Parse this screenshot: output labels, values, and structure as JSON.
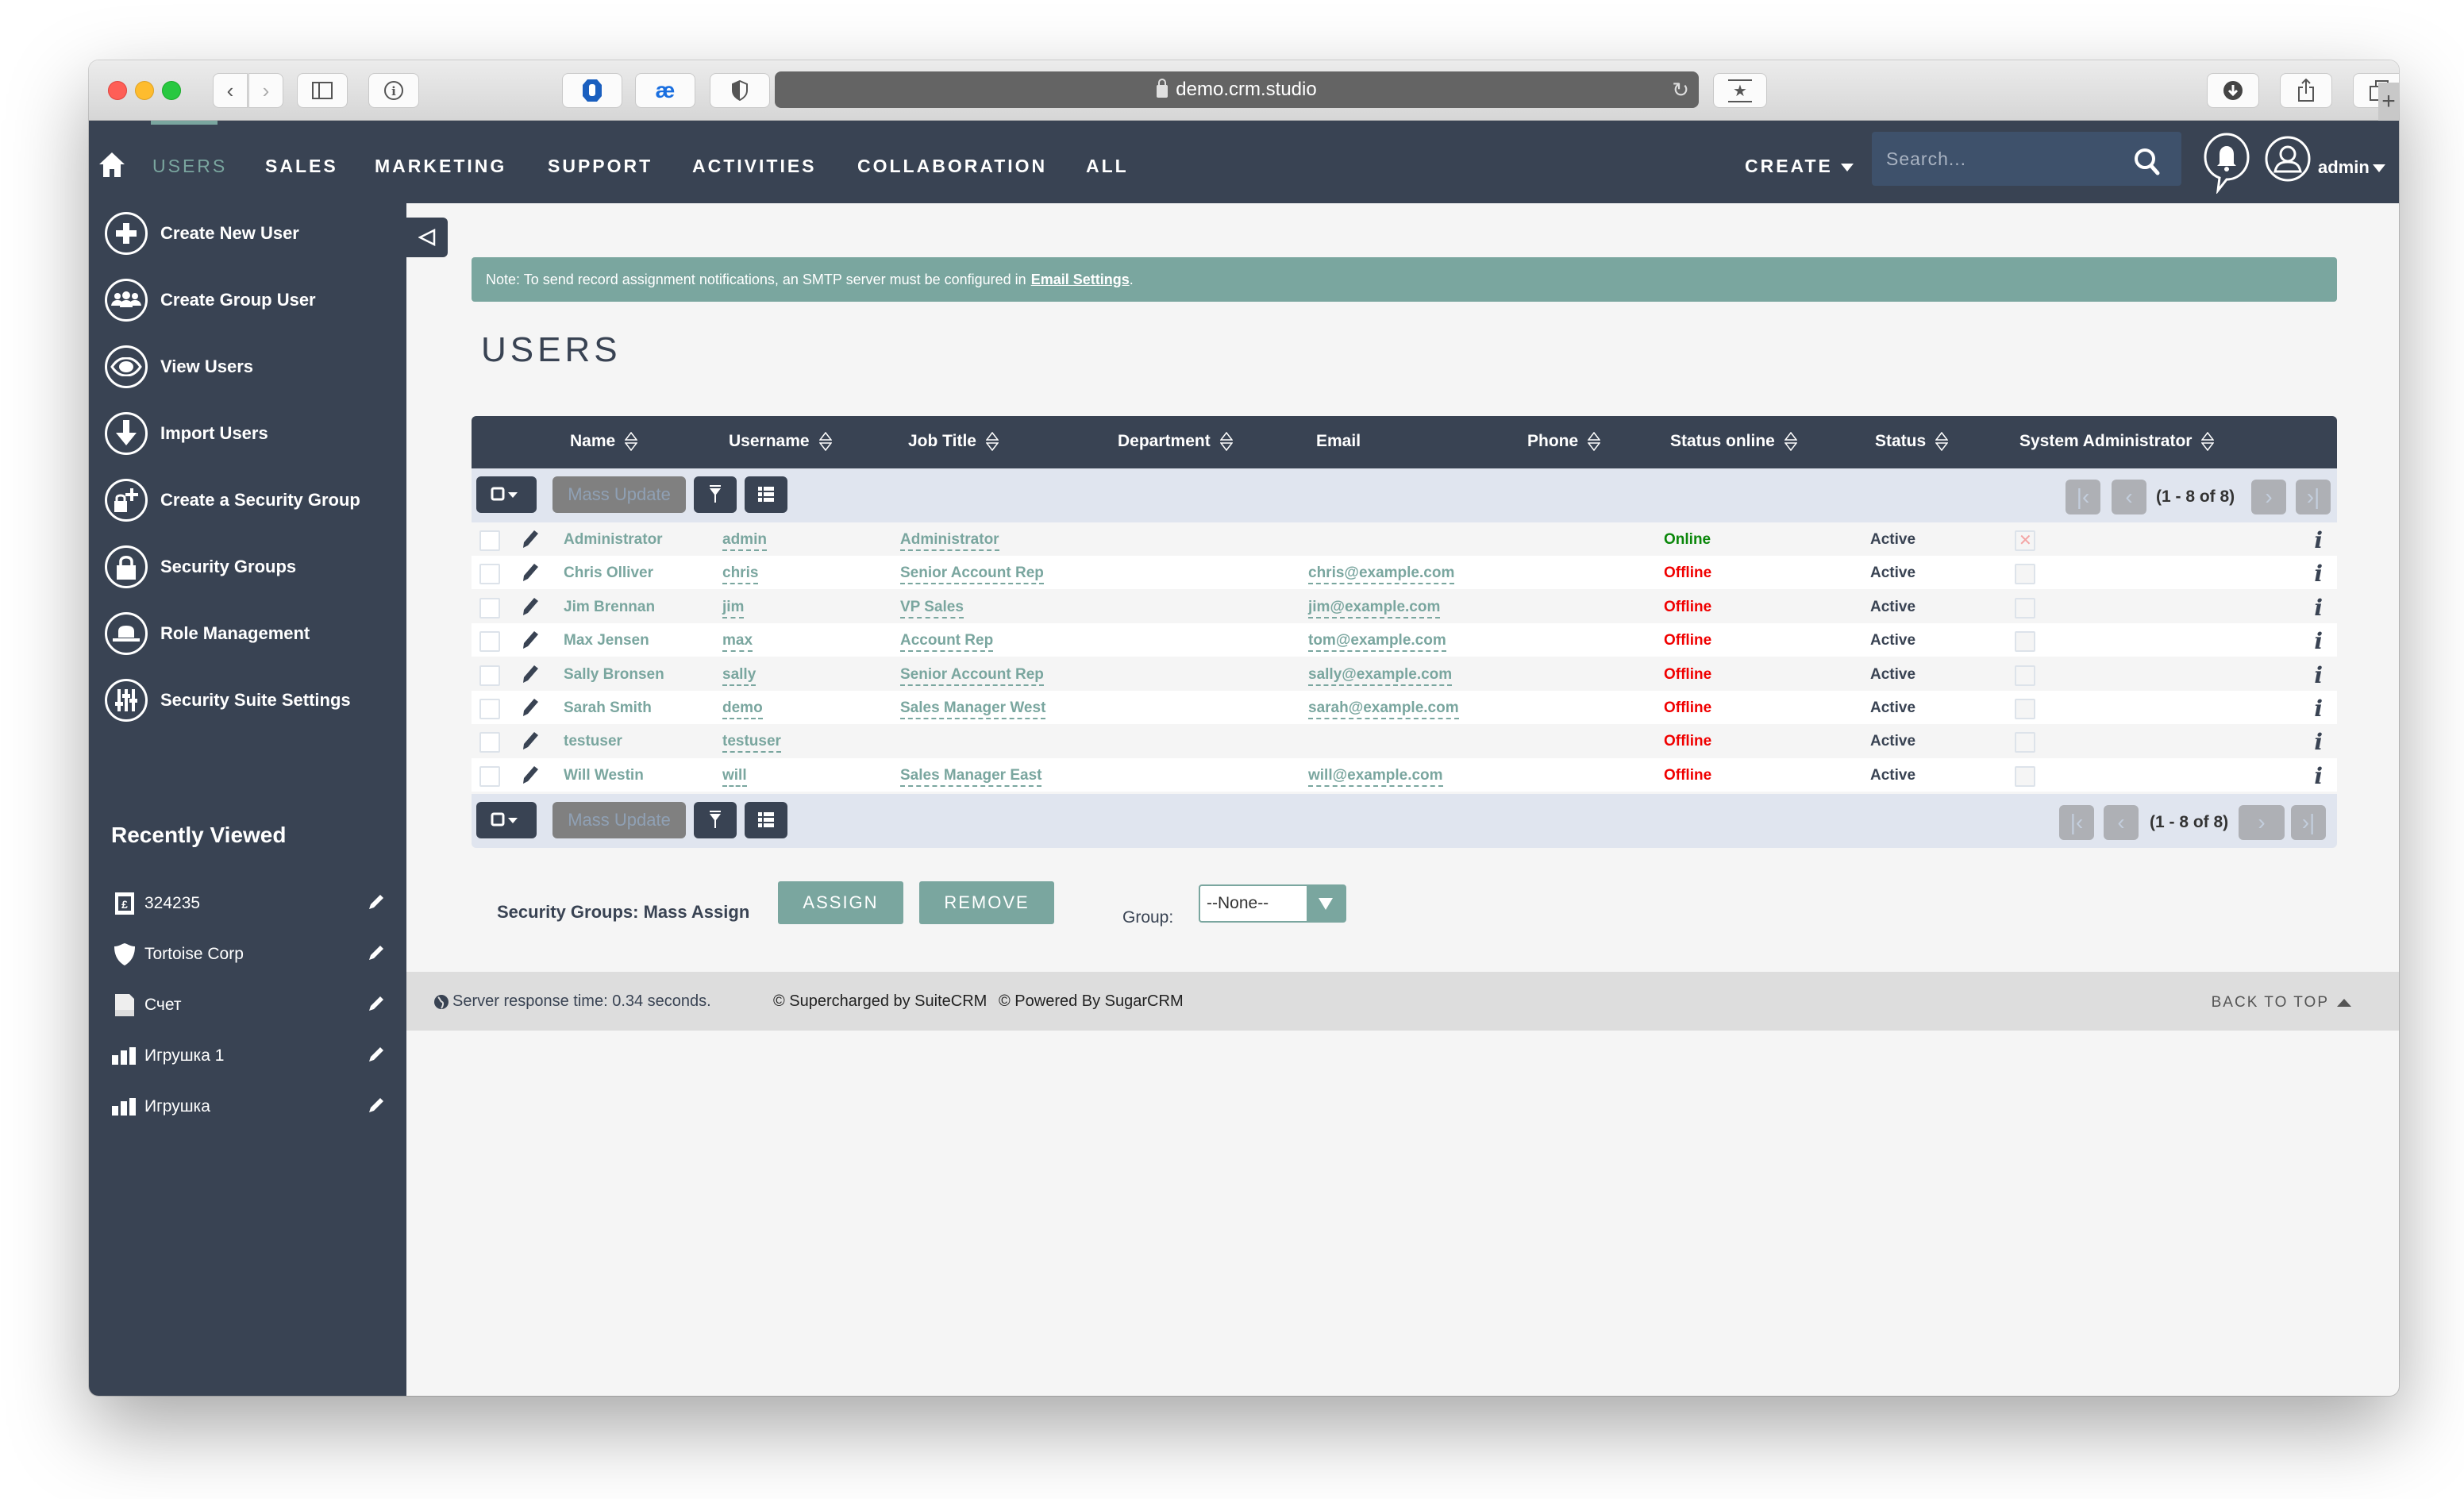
{
  "browser": {
    "url": "demo.crm.studio",
    "toolbar_icons": [
      "back-icon",
      "forward-icon",
      "sidebar-icon",
      "info-icon",
      "adblock-hand-icon",
      "ae-extension-icon",
      "shield-icon",
      "reader-star-icon",
      "download-icon",
      "share-icon",
      "tabs-icon",
      "new-tab-icon"
    ],
    "new_tab": "+"
  },
  "navbar": {
    "items": [
      {
        "label": "USERS",
        "active": true
      },
      {
        "label": "SALES"
      },
      {
        "label": "MARKETING"
      },
      {
        "label": "SUPPORT"
      },
      {
        "label": "ACTIVITIES"
      },
      {
        "label": "COLLABORATION"
      },
      {
        "label": "ALL"
      }
    ],
    "create_label": "CREATE",
    "search_placeholder": "Search...",
    "user_label": "admin"
  },
  "sidebar": {
    "actions": [
      {
        "label": "Create New User",
        "icon": "plus-icon"
      },
      {
        "label": "Create Group User",
        "icon": "group-icon"
      },
      {
        "label": "View Users",
        "icon": "eye-icon"
      },
      {
        "label": "Import Users",
        "icon": "import-arrow-icon"
      },
      {
        "label": "Create a Security Group",
        "icon": "lock-plus-icon"
      },
      {
        "label": "Security Groups",
        "icon": "lock-icon"
      },
      {
        "label": "Role Management",
        "icon": "hat-icon"
      },
      {
        "label": "Security Suite Settings",
        "icon": "sliders-icon"
      }
    ],
    "recent_title": "Recently Viewed",
    "recent": [
      {
        "label": "324235",
        "icon": "invoice-pound-icon"
      },
      {
        "label": "Tortoise Corp",
        "icon": "shield-account-icon"
      },
      {
        "label": "Счет",
        "icon": "pdf-document-icon"
      },
      {
        "label": "Игрушка 1",
        "icon": "product-bars-icon"
      },
      {
        "label": "Игрушка",
        "icon": "product-bars-icon"
      }
    ]
  },
  "notice": {
    "text": "Note: To send record assignment notifications, an SMTP server must be configured in",
    "link": "Email Settings",
    "suffix": "."
  },
  "page_title": "USERS",
  "table": {
    "columns": [
      "Name",
      "Username",
      "Job Title",
      "Department",
      "Email",
      "Phone",
      "Status online",
      "Status",
      "System Administrator"
    ],
    "sortable": [
      true,
      true,
      true,
      true,
      false,
      true,
      true,
      true,
      true
    ],
    "rows": [
      {
        "name": "Administrator",
        "username": "admin",
        "job_title": "Administrator",
        "department": "",
        "email": "",
        "phone": "",
        "status_online": "Online",
        "status": "Active",
        "is_admin": true
      },
      {
        "name": "Chris Olliver",
        "username": "chris",
        "job_title": "Senior Account Rep",
        "department": "",
        "email": "chris@example.com",
        "phone": "",
        "status_online": "Offline",
        "status": "Active",
        "is_admin": false
      },
      {
        "name": "Jim Brennan",
        "username": "jim",
        "job_title": "VP Sales",
        "department": "",
        "email": "jim@example.com",
        "phone": "",
        "status_online": "Offline",
        "status": "Active",
        "is_admin": false
      },
      {
        "name": "Max Jensen",
        "username": "max",
        "job_title": "Account Rep",
        "department": "",
        "email": "tom@example.com",
        "phone": "",
        "status_online": "Offline",
        "status": "Active",
        "is_admin": false
      },
      {
        "name": "Sally Bronsen",
        "username": "sally",
        "job_title": "Senior Account Rep",
        "department": "",
        "email": "sally@example.com",
        "phone": "",
        "status_online": "Offline",
        "status": "Active",
        "is_admin": false
      },
      {
        "name": "Sarah Smith",
        "username": "demo",
        "job_title": "Sales Manager West",
        "department": "",
        "email": "sarah@example.com",
        "phone": "",
        "status_online": "Offline",
        "status": "Active",
        "is_admin": false
      },
      {
        "name": "testuser",
        "username": "testuser",
        "job_title": "",
        "department": "",
        "email": "",
        "phone": "",
        "status_online": "Offline",
        "status": "Active",
        "is_admin": false
      },
      {
        "name": "Will Westin",
        "username": "will",
        "job_title": "Sales Manager East",
        "department": "",
        "email": "will@example.com",
        "phone": "",
        "status_online": "Offline",
        "status": "Active",
        "is_admin": false
      }
    ],
    "mass_update_label": "Mass Update",
    "pagination": "(1 - 8 of 8)"
  },
  "mass_assign": {
    "label": "Security Groups: Mass Assign",
    "assign_label": "ASSIGN",
    "remove_label": "REMOVE",
    "group_label": "Group:",
    "group_value": "--None--"
  },
  "footer": {
    "response_time": "Server response time: 0.34 seconds.",
    "supercharged": "© Supercharged by SuiteCRM",
    "powered": "© Powered By SugarCRM",
    "back_to_top": "BACK TO TOP"
  },
  "colors": {
    "navbar": "#394353",
    "accent": "#7aa69f",
    "online": "#0a870a",
    "offline": "#f00000",
    "toolbar_bg": "#e0e5ef"
  }
}
